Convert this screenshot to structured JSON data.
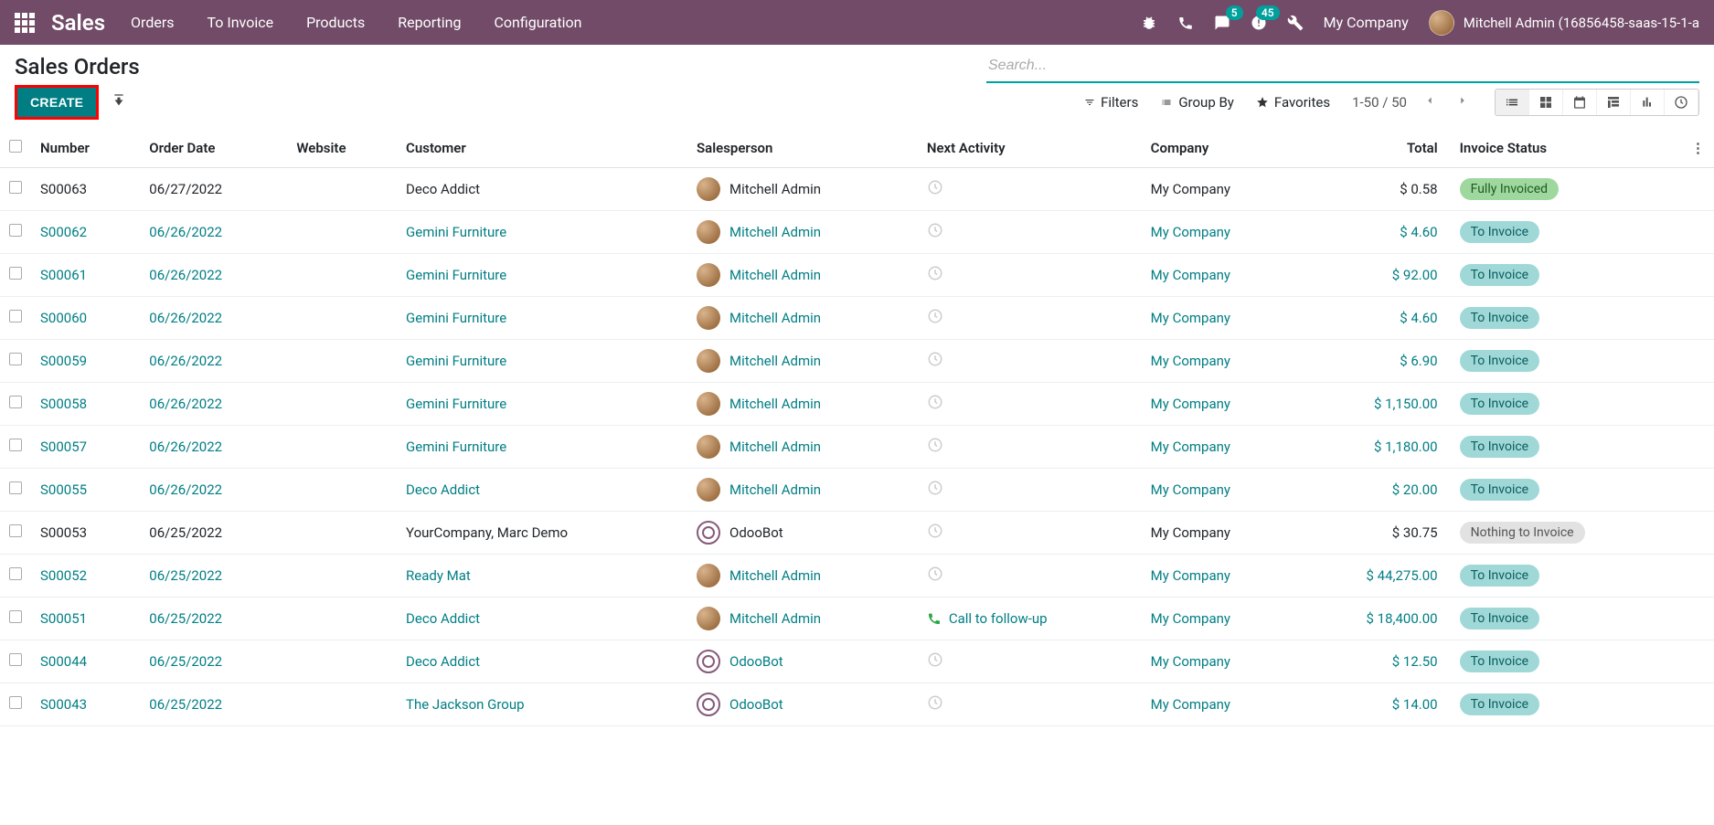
{
  "navbar": {
    "brand": "Sales",
    "menu": [
      "Orders",
      "To Invoice",
      "Products",
      "Reporting",
      "Configuration"
    ],
    "msg_badge": "5",
    "activity_badge": "45",
    "company": "My Company",
    "user": "Mitchell Admin (16856458-saas-15-1-a"
  },
  "page": {
    "title": "Sales Orders",
    "create_label": "CREATE",
    "search_placeholder": "Search...",
    "filters": "Filters",
    "groupby": "Group By",
    "favorites": "Favorites",
    "pager": "1-50 / 50"
  },
  "headers": {
    "number": "Number",
    "order_date": "Order Date",
    "website": "Website",
    "customer": "Customer",
    "salesperson": "Salesperson",
    "next_activity": "Next Activity",
    "company": "Company",
    "total": "Total",
    "invoice_status": "Invoice Status"
  },
  "rows": [
    {
      "number": "S00063",
      "date": "06/27/2022",
      "customer": "Deco Addict",
      "sp": "Mitchell Admin",
      "sp_type": "user",
      "activity": "",
      "company": "My Company",
      "total": "$ 0.58",
      "status": "Fully Invoiced",
      "status_class": "status-full",
      "link": false
    },
    {
      "number": "S00062",
      "date": "06/26/2022",
      "customer": "Gemini Furniture",
      "sp": "Mitchell Admin",
      "sp_type": "user",
      "activity": "",
      "company": "My Company",
      "total": "$ 4.60",
      "status": "To Invoice",
      "status_class": "status-toinvoice",
      "link": true
    },
    {
      "number": "S00061",
      "date": "06/26/2022",
      "customer": "Gemini Furniture",
      "sp": "Mitchell Admin",
      "sp_type": "user",
      "activity": "",
      "company": "My Company",
      "total": "$ 92.00",
      "status": "To Invoice",
      "status_class": "status-toinvoice",
      "link": true
    },
    {
      "number": "S00060",
      "date": "06/26/2022",
      "customer": "Gemini Furniture",
      "sp": "Mitchell Admin",
      "sp_type": "user",
      "activity": "",
      "company": "My Company",
      "total": "$ 4.60",
      "status": "To Invoice",
      "status_class": "status-toinvoice",
      "link": true
    },
    {
      "number": "S00059",
      "date": "06/26/2022",
      "customer": "Gemini Furniture",
      "sp": "Mitchell Admin",
      "sp_type": "user",
      "activity": "",
      "company": "My Company",
      "total": "$ 6.90",
      "status": "To Invoice",
      "status_class": "status-toinvoice",
      "link": true
    },
    {
      "number": "S00058",
      "date": "06/26/2022",
      "customer": "Gemini Furniture",
      "sp": "Mitchell Admin",
      "sp_type": "user",
      "activity": "",
      "company": "My Company",
      "total": "$ 1,150.00",
      "status": "To Invoice",
      "status_class": "status-toinvoice",
      "link": true
    },
    {
      "number": "S00057",
      "date": "06/26/2022",
      "customer": "Gemini Furniture",
      "sp": "Mitchell Admin",
      "sp_type": "user",
      "activity": "",
      "company": "My Company",
      "total": "$ 1,180.00",
      "status": "To Invoice",
      "status_class": "status-toinvoice",
      "link": true
    },
    {
      "number": "S00055",
      "date": "06/26/2022",
      "customer": "Deco Addict",
      "sp": "Mitchell Admin",
      "sp_type": "user",
      "activity": "",
      "company": "My Company",
      "total": "$ 20.00",
      "status": "To Invoice",
      "status_class": "status-toinvoice",
      "link": true
    },
    {
      "number": "S00053",
      "date": "06/25/2022",
      "customer": "YourCompany, Marc Demo",
      "sp": "OdooBot",
      "sp_type": "bot",
      "activity": "",
      "company": "My Company",
      "total": "$ 30.75",
      "status": "Nothing to Invoice",
      "status_class": "status-nothing",
      "link": false
    },
    {
      "number": "S00052",
      "date": "06/25/2022",
      "customer": "Ready Mat",
      "sp": "Mitchell Admin",
      "sp_type": "user",
      "activity": "",
      "company": "My Company",
      "total": "$ 44,275.00",
      "status": "To Invoice",
      "status_class": "status-toinvoice",
      "link": true
    },
    {
      "number": "S00051",
      "date": "06/25/2022",
      "customer": "Deco Addict",
      "sp": "Mitchell Admin",
      "sp_type": "user",
      "activity": "Call to follow-up",
      "company": "My Company",
      "total": "$ 18,400.00",
      "status": "To Invoice",
      "status_class": "status-toinvoice",
      "link": true
    },
    {
      "number": "S00044",
      "date": "06/25/2022",
      "customer": "Deco Addict",
      "sp": "OdooBot",
      "sp_type": "bot",
      "activity": "",
      "company": "My Company",
      "total": "$ 12.50",
      "status": "To Invoice",
      "status_class": "status-toinvoice",
      "link": true
    },
    {
      "number": "S00043",
      "date": "06/25/2022",
      "customer": "The Jackson Group",
      "sp": "OdooBot",
      "sp_type": "bot",
      "activity": "",
      "company": "My Company",
      "total": "$ 14.00",
      "status": "To Invoice",
      "status_class": "status-toinvoice",
      "link": true
    }
  ]
}
